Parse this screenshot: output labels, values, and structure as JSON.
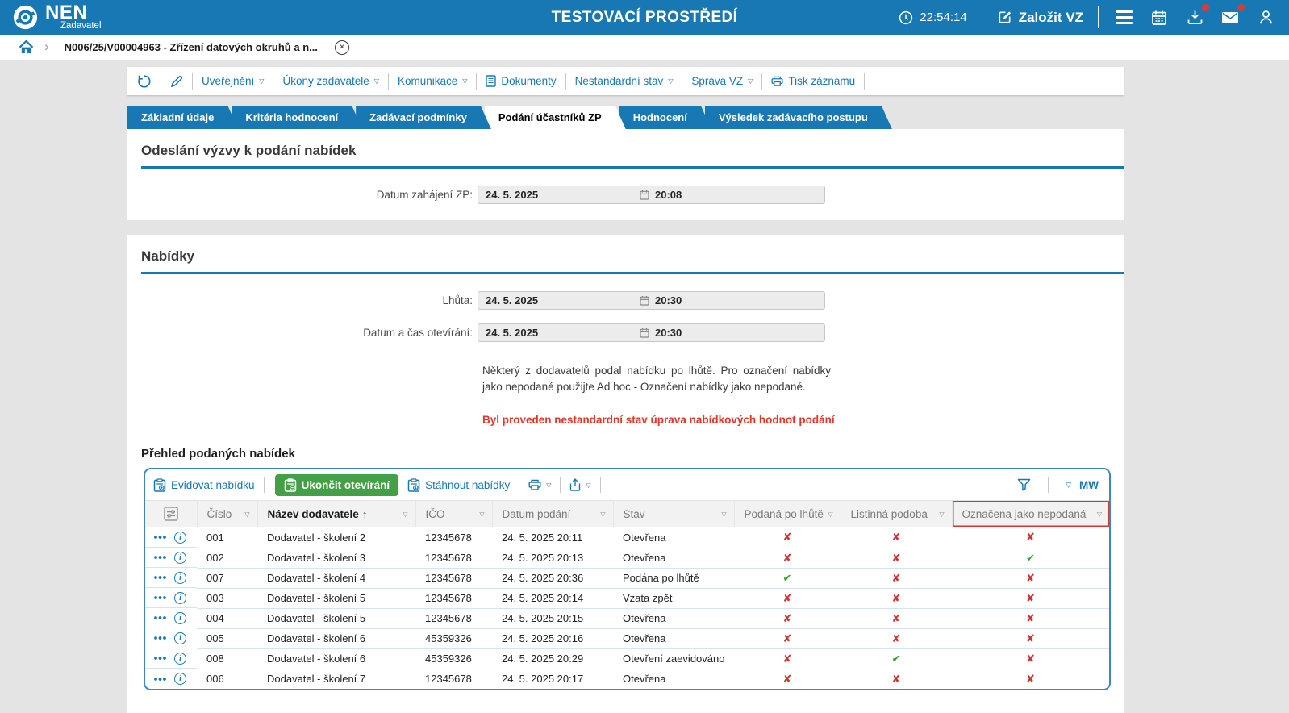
{
  "colors": {
    "accent": "#1878b4",
    "button_green": "#43a047",
    "cross_red": "#d1312e",
    "check_green": "#2fa42f",
    "warning_red": "#e5342a",
    "highlight_border_red": "#cf3835"
  },
  "header": {
    "logo_text": "NEN",
    "logo_subtext": "Zadavatel",
    "env_title": "TESTOVACÍ PROSTŘEDÍ",
    "time": "22:54:14",
    "create_vz": "Založit VZ"
  },
  "breadcrumb": {
    "item": "N006/25/V00004963 - Zřízení datových okruhů a n..."
  },
  "command_bar": {
    "items": [
      {
        "label": "Uveřejnění",
        "dropdown": true
      },
      {
        "label": "Úkony zadavatele",
        "dropdown": true
      },
      {
        "label": "Komunikace",
        "dropdown": true
      },
      {
        "label": "Dokumenty",
        "icon": "document"
      },
      {
        "label": "Nestandardní stav",
        "dropdown": true
      },
      {
        "label": "Správa VZ",
        "dropdown": true
      },
      {
        "label": "Tisk záznamu",
        "icon": "printer"
      }
    ]
  },
  "tabs": [
    {
      "label": "Základní údaje",
      "active": false
    },
    {
      "label": "Kritéria hodnocení",
      "active": false
    },
    {
      "label": "Zadávací podmínky",
      "active": false
    },
    {
      "label": "Podání účastníků ZP",
      "active": true
    },
    {
      "label": "Hodnocení",
      "active": false
    },
    {
      "label": "Výsledek zadávacího postupu",
      "active": false
    }
  ],
  "invitation_section": {
    "title": "Odeslání výzvy k podání nabídek",
    "field_label": "Datum zahájení ZP:",
    "date": "24. 5. 2025",
    "time": "20:08"
  },
  "offers_section": {
    "title": "Nabídky",
    "deadline_label": "Lhůta:",
    "deadline_date": "24. 5. 2025",
    "deadline_time": "20:30",
    "opening_label": "Datum a čas otevírání:",
    "opening_date": "24. 5. 2025",
    "opening_time": "20:30",
    "note": "Některý z dodavatelů podal nabídku po lhůtě. Pro označení nabídky jako nepodané použijte Ad hoc - Označení nabídky jako nepodané.",
    "warning": "Byl proveden nestandardní stav úprava nabídkových hodnot podání"
  },
  "offers_table": {
    "title": "Přehled podaných nabídek",
    "buttons": {
      "register": "Evidovat nabídku",
      "finish_opening": "Ukončit otevírání",
      "download": "Stáhnout nabídky"
    },
    "user_initials": "MW",
    "columns": [
      "Číslo",
      "Název dodavatele",
      "IČO",
      "Datum podání",
      "Stav",
      "Podaná po lhůtě",
      "Listinná podoba",
      "Označena jako nepodaná"
    ],
    "sorted_column": "Název dodavatele",
    "highlighted_column": "Označena jako nepodaná",
    "rows": [
      {
        "cislo": "001",
        "nazev": "Dodavatel - školení 2",
        "ico": "12345678",
        "datum": "24. 5. 2025 20:11",
        "stav": "Otevřena",
        "podana_po_lhute": false,
        "listinna_podoba": false,
        "oznacena_jako_nepodana": false
      },
      {
        "cislo": "002",
        "nazev": "Dodavatel - školení 3",
        "ico": "12345678",
        "datum": "24. 5. 2025 20:13",
        "stav": "Otevřena",
        "podana_po_lhute": false,
        "listinna_podoba": false,
        "oznacena_jako_nepodana": true
      },
      {
        "cislo": "007",
        "nazev": "Dodavatel - školení 4",
        "ico": "12345678",
        "datum": "24. 5. 2025 20:36",
        "stav": "Podána po lhůtě",
        "podana_po_lhute": true,
        "listinna_podoba": false,
        "oznacena_jako_nepodana": false
      },
      {
        "cislo": "003",
        "nazev": "Dodavatel - školení 5",
        "ico": "12345678",
        "datum": "24. 5. 2025 20:14",
        "stav": "Vzata zpět",
        "podana_po_lhute": false,
        "listinna_podoba": false,
        "oznacena_jako_nepodana": false
      },
      {
        "cislo": "004",
        "nazev": "Dodavatel - školení 5",
        "ico": "12345678",
        "datum": "24. 5. 2025 20:15",
        "stav": "Otevřena",
        "podana_po_lhute": false,
        "listinna_podoba": false,
        "oznacena_jako_nepodana": false
      },
      {
        "cislo": "005",
        "nazev": "Dodavatel - školení 6",
        "ico": "45359326",
        "datum": "24. 5. 2025 20:16",
        "stav": "Otevřena",
        "podana_po_lhute": false,
        "listinna_podoba": false,
        "oznacena_jako_nepodana": false
      },
      {
        "cislo": "008",
        "nazev": "Dodavatel - školení 6",
        "ico": "45359326",
        "datum": "24. 5. 2025 20:29",
        "stav": "Otevření zaevidováno",
        "podana_po_lhute": false,
        "listinna_podoba": true,
        "oznacena_jako_nepodana": false
      },
      {
        "cislo": "006",
        "nazev": "Dodavatel - školení 7",
        "ico": "12345678",
        "datum": "24. 5. 2025 20:17",
        "stav": "Otevřena",
        "podana_po_lhute": false,
        "listinna_podoba": false,
        "oznacena_jako_nepodana": false
      }
    ]
  }
}
